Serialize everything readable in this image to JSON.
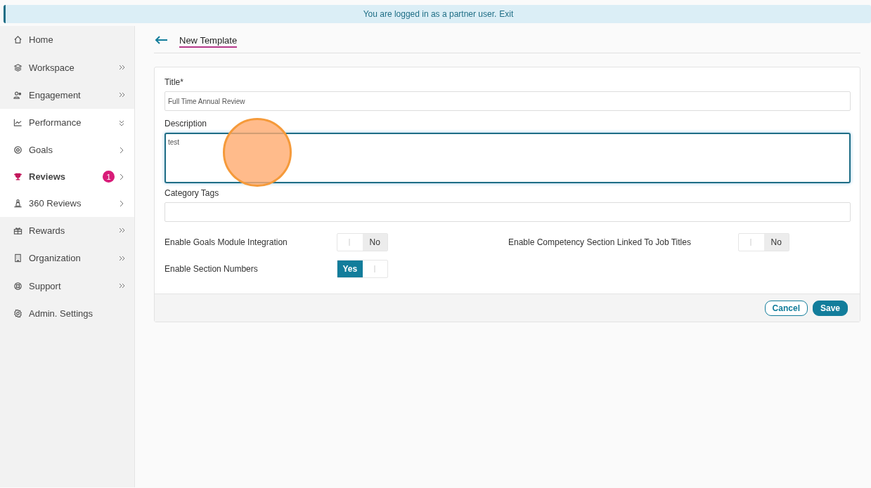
{
  "banner": {
    "text": "You are logged in as a partner user.",
    "link": "Exit"
  },
  "sidebar": {
    "items": [
      {
        "label": "Home",
        "kind": "link",
        "selected": false
      },
      {
        "label": "Workspace",
        "kind": "group",
        "expanded": false,
        "selected": false
      },
      {
        "label": "Engagement",
        "kind": "group",
        "expanded": false,
        "selected": false
      },
      {
        "label": "Performance",
        "kind": "group",
        "expanded": true,
        "selected": false,
        "children": [
          {
            "label": "Goals",
            "kind": "sub",
            "selected": false
          },
          {
            "label": "Reviews",
            "kind": "sub",
            "selected": true,
            "badge": "1"
          },
          {
            "label": "360 Reviews",
            "kind": "sub",
            "selected": false
          }
        ]
      },
      {
        "label": "Rewards",
        "kind": "group",
        "expanded": false,
        "selected": false
      },
      {
        "label": "Organization",
        "kind": "group",
        "expanded": false,
        "selected": false
      },
      {
        "label": "Support",
        "kind": "group",
        "expanded": false,
        "selected": false
      },
      {
        "label": "Admin. Settings",
        "kind": "link",
        "selected": false
      }
    ]
  },
  "page": {
    "title": "New Template"
  },
  "form": {
    "fields": [
      {
        "label": "Title*",
        "kind": "input",
        "value": "Full Time Annual Review",
        "focused": false
      },
      {
        "label": "Description",
        "kind": "textarea",
        "value": "test",
        "focused": true
      },
      {
        "label": "Category Tags",
        "kind": "input",
        "focused": false
      }
    ],
    "toggles": [
      {
        "label": "Enable Goals Module Integration",
        "on": false,
        "state_text": "No"
      },
      {
        "label": "Enable Competency Section Linked To Job Titles",
        "on": false,
        "state_text": "No"
      },
      {
        "label": "Enable Section Numbers",
        "on": true,
        "state_text": "Yes"
      }
    ],
    "buttons": [
      {
        "label": "Cancel",
        "kind": "secondary"
      },
      {
        "label": "Save",
        "kind": "primary"
      }
    ]
  },
  "click_marker": {
    "visible": true
  }
}
